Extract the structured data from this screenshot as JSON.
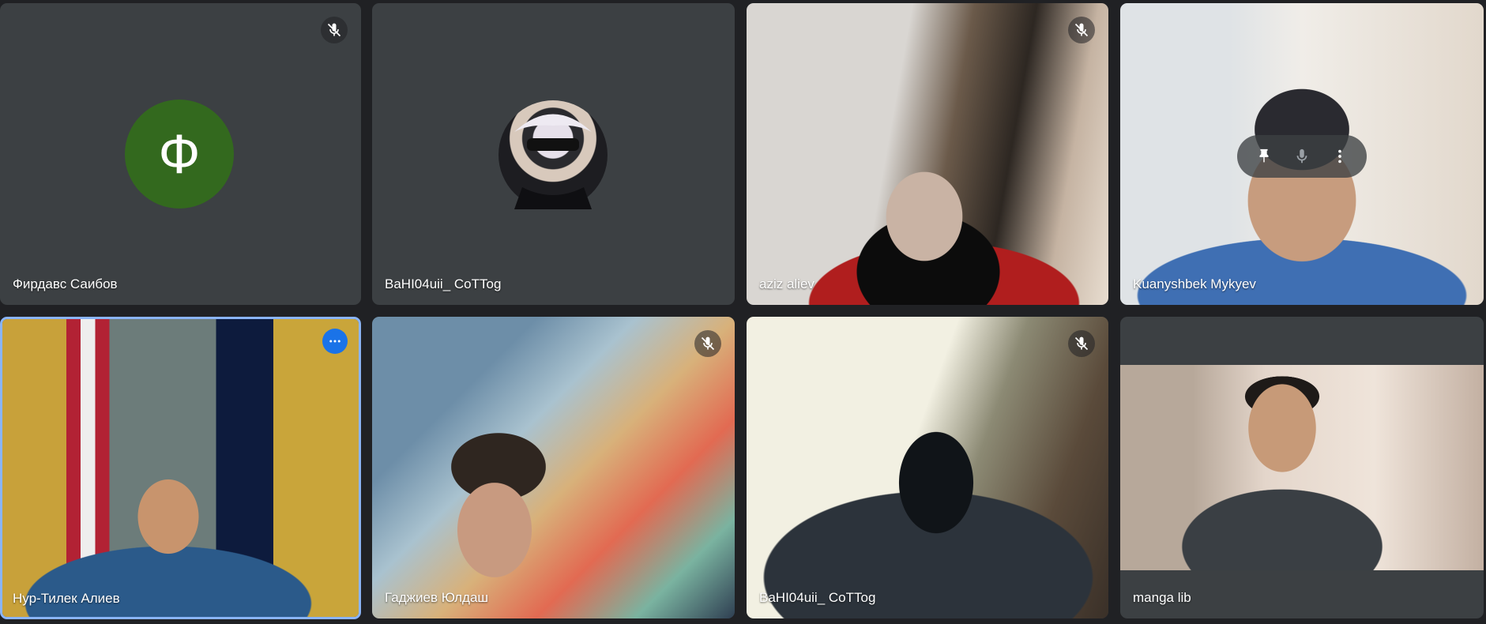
{
  "participants": [
    {
      "name": "Фирдавс Саибов",
      "avatar_letter": "Ф",
      "avatar_color": "#33691e",
      "muted": true
    },
    {
      "name": "BaHI04uii_ CoTTog",
      "muted": false
    },
    {
      "name": "aziz aliev",
      "muted": true
    },
    {
      "name": "Kuanyshbek Mykyev",
      "muted": false,
      "hover_controls": [
        "pin-icon",
        "mic-icon",
        "more-vert-icon"
      ]
    },
    {
      "name": "Нур-Тилек Алиев",
      "muted": false,
      "active": true
    },
    {
      "name": "Гаджиев Юлдаш",
      "muted": true
    },
    {
      "name": "BaHI04uii_ CoTTog",
      "muted": true
    },
    {
      "name": "manga lib",
      "muted": false
    }
  ],
  "colors": {
    "background": "#202124",
    "tile": "#3c4043",
    "active_border": "#8ab4f8",
    "accent": "#1a73e8"
  }
}
